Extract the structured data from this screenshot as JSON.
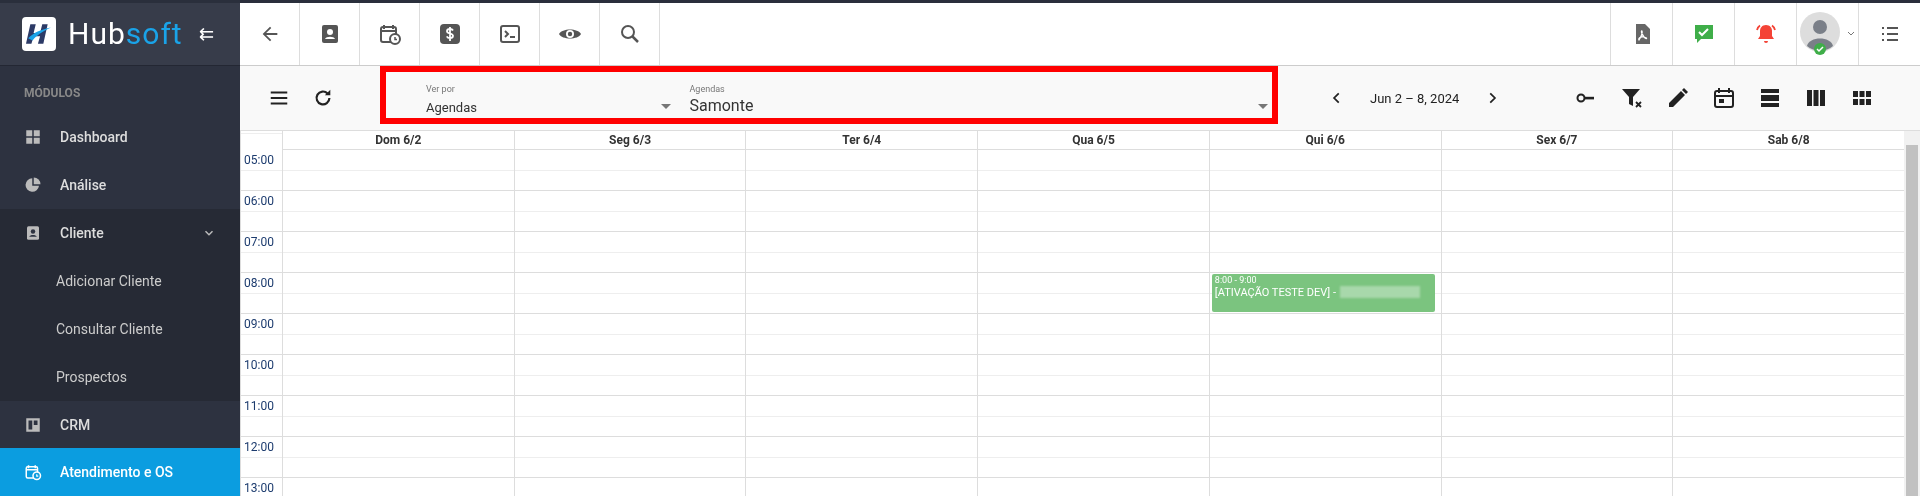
{
  "brand": {
    "name_part1": "Hub",
    "name_part2": "soft",
    "collapse_icon": "⇇"
  },
  "sidebar": {
    "section_label": "MÓDULOS",
    "items": [
      {
        "label": "Dashboard",
        "selected": false
      },
      {
        "label": "Análise",
        "selected": false
      },
      {
        "label": "Cliente",
        "selected": false,
        "expanded": true,
        "children": [
          {
            "label": "Adicionar Cliente",
            "selected": false
          },
          {
            "label": "Consultar Cliente",
            "selected": false
          },
          {
            "label": "Prospectos",
            "selected": false
          }
        ]
      },
      {
        "label": "CRM",
        "selected": false
      },
      {
        "label": "Atendimento e OS",
        "selected": true
      }
    ]
  },
  "filters": {
    "view_by": {
      "label": "Ver por",
      "value": "Agendas"
    },
    "agendas": {
      "label": "Agendas",
      "value": "Samonte"
    }
  },
  "date_range": "Jun 2 – 8, 2024",
  "calendar": {
    "days": [
      {
        "label": "Dom 6/2"
      },
      {
        "label": "Seg 6/3"
      },
      {
        "label": "Ter 6/4"
      },
      {
        "label": "Qua 6/5"
      },
      {
        "label": "Qui 6/6",
        "events": [
          {
            "time": "8:00 - 9:00",
            "title": "[ATIVAÇÃO TESTE DEV] -",
            "color": "#7bc47f"
          }
        ]
      },
      {
        "label": "Sex 6/7"
      },
      {
        "label": "Sab 6/8"
      }
    ],
    "hours": [
      "05:00",
      "06:00",
      "07:00",
      "08:00",
      "09:00",
      "10:00",
      "11:00",
      "12:00",
      "13:00"
    ]
  }
}
